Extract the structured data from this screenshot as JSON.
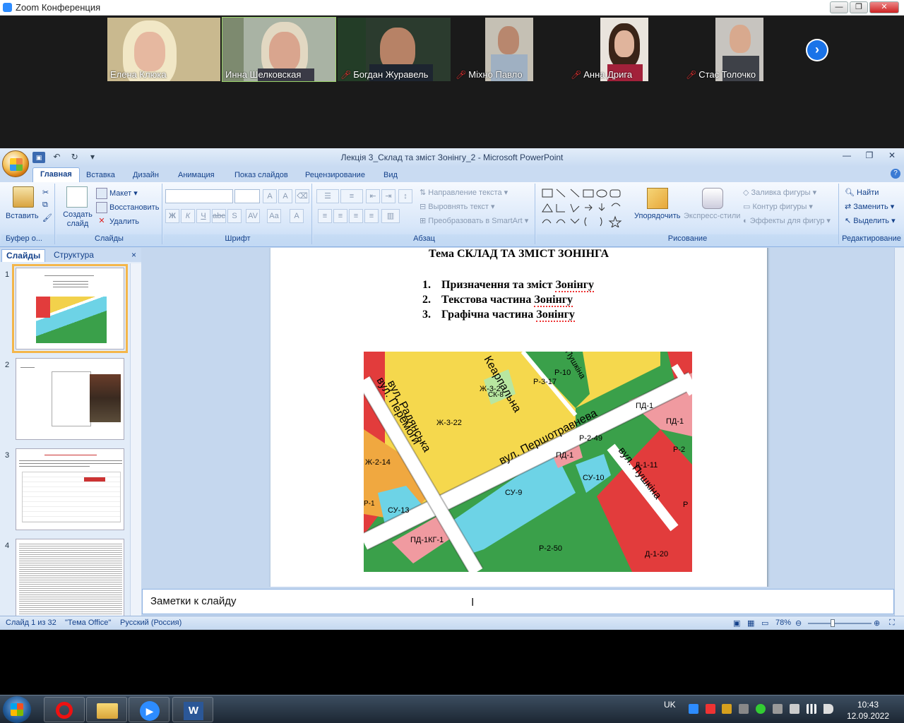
{
  "zoom": {
    "title": "Zoom Конференция",
    "participants": [
      {
        "name": "Елена Клюка",
        "muted": false,
        "active": false
      },
      {
        "name": "Инна Шелковская",
        "muted": false,
        "active": true
      },
      {
        "name": "Богдан Журавель",
        "muted": true,
        "active": false
      },
      {
        "name": "Міхно Павло",
        "muted": true,
        "active": false
      },
      {
        "name": "Анна Дрига",
        "muted": true,
        "active": false
      },
      {
        "name": "Стас Толочко",
        "muted": true,
        "active": false
      }
    ]
  },
  "ppt": {
    "window_title": "Лекція 3_Склад та зміст Зонінгу_2 - Microsoft PowerPoint",
    "tabs": [
      "Главная",
      "Вставка",
      "Дизайн",
      "Анимация",
      "Показ слайдов",
      "Рецензирование",
      "Вид"
    ],
    "ribbon": {
      "clipboard": {
        "paste": "Вставить",
        "label": "Буфер о..."
      },
      "slides": {
        "new_slide": "Создать слайд",
        "layout": "Макет",
        "reset": "Восстановить",
        "delete": "Удалить",
        "label": "Слайды"
      },
      "font": {
        "label": "Шрифт"
      },
      "paragraph": {
        "text_direction": "Направление текста",
        "align_text": "Выровнять текст",
        "convert_smartart": "Преобразовать в SmartArt",
        "label": "Абзац"
      },
      "drawing": {
        "arrange": "Упорядочить",
        "quick_styles": "Экспресс-стили",
        "shape_fill": "Заливка фигуры",
        "shape_outline": "Контур фигуры",
        "shape_effects": "Эффекты для фигур",
        "label": "Рисование"
      },
      "editing": {
        "find": "Найти",
        "replace": "Заменить",
        "select": "Выделить",
        "label": "Редактирование"
      }
    },
    "pane_tabs": [
      "Слайды",
      "Структура"
    ],
    "slide": {
      "title": "Тема СКЛАД ТА ЗМІСТ ЗОНІНГА",
      "items": [
        {
          "num": "1.",
          "text": "Призначення та зміст ",
          "word": "Зонінгу"
        },
        {
          "num": "2.",
          "text": "Текстова частина ",
          "word": "Зонінгу"
        },
        {
          "num": "3.",
          "text": "Графічна частина ",
          "word": "Зонінгу"
        }
      ],
      "map_labels": [
        "вул. Радянська",
        "Кеарпальна",
        "вул. Перемоги",
        "вул. Першотравнева",
        "вул. Пушкіна",
        "Пушкіна",
        "Ж-3-2",
        "СК-8",
        "Р-3-17",
        "Р-10",
        "Ж-3-22",
        "ПД-1",
        "ПД-1",
        "Р-2-49",
        "Р-2",
        "Ж-2-14",
        "ПД-1",
        "СУ-10",
        "Д-1-11",
        "СУ-9",
        "СУ-13",
        "ПД-1КГ-1",
        "Р-2-50",
        "Д-1-20",
        "Р",
        "Р-1"
      ]
    },
    "notes_placeholder": "Заметки к слайду",
    "status": {
      "slide": "Слайд 1 из 32",
      "theme": "\"Тема Office\"",
      "language": "Русский (Россия)",
      "zoom": "78%"
    },
    "thumbnails": [
      {
        "num": "1",
        "selected": true
      },
      {
        "num": "2",
        "selected": false
      },
      {
        "num": "3",
        "selected": false
      },
      {
        "num": "4",
        "selected": false
      }
    ]
  },
  "taskbar": {
    "lang": "UK",
    "time": "10:43",
    "date": "12.09.2022"
  }
}
